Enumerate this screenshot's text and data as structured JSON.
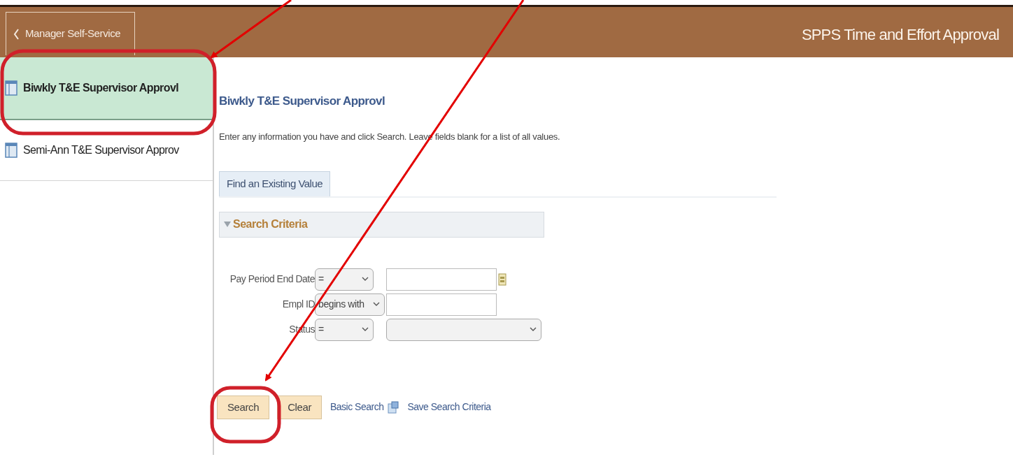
{
  "header": {
    "back_button": "Manager Self-Service",
    "title": "SPPS Time and Effort Approval"
  },
  "sidebar": {
    "items": [
      {
        "label": "Biwkly T&E Supervisor Approvl",
        "selected": true
      },
      {
        "label": "Semi-Ann T&E Supervisor Approv",
        "selected": false
      }
    ]
  },
  "page_title": "Biwkly T&E Supervisor Approvl",
  "instructions": "Enter any information you have and click Search. Leave fields blank for a list of all values.",
  "tabs": [
    {
      "label": "Find an Existing Value",
      "selected": true
    }
  ],
  "section": {
    "title": "Search Criteria",
    "expanded": true
  },
  "fields": [
    {
      "label": "Pay Period End Date",
      "operator": "=",
      "kind": "date"
    },
    {
      "label": "Empl ID",
      "operator": "begins with",
      "kind": "text"
    },
    {
      "label": "Status",
      "operator": "=",
      "kind": "select"
    }
  ],
  "buttons": [
    {
      "label": "Search"
    },
    {
      "label": "Clear"
    }
  ],
  "links": [
    {
      "label": "Basic Search",
      "kind": "plain"
    },
    {
      "label": "Save Search Criteria",
      "kind": "with-icon"
    }
  ]
}
